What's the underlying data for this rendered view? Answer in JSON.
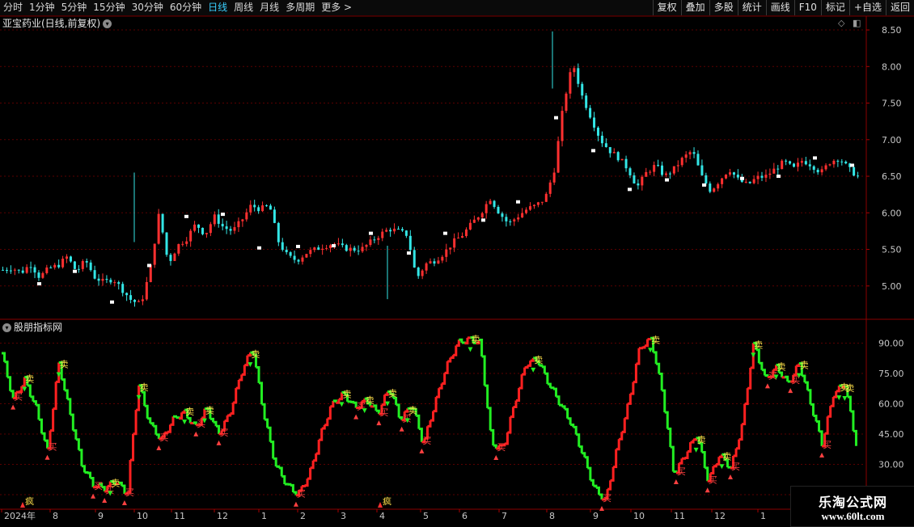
{
  "toolbar": {
    "periods": [
      {
        "label": "分时",
        "active": false
      },
      {
        "label": "1分钟",
        "active": false
      },
      {
        "label": "5分钟",
        "active": false
      },
      {
        "label": "15分钟",
        "active": false
      },
      {
        "label": "30分钟",
        "active": false
      },
      {
        "label": "60分钟",
        "active": false
      },
      {
        "label": "日线",
        "active": true
      },
      {
        "label": "周线",
        "active": false
      },
      {
        "label": "月线",
        "active": false
      },
      {
        "label": "多周期",
        "active": false
      },
      {
        "label": "更多 >",
        "active": false
      }
    ],
    "actions": [
      "复权",
      "叠加",
      "多股",
      "统计",
      "画线",
      "F10",
      "标记",
      "+自选",
      "返回"
    ]
  },
  "main_panel": {
    "title": "亚宝药业(日线,前复权)"
  },
  "indicator_panel": {
    "title": "股朋指标网"
  },
  "watermark": {
    "name": "乐淘公式网",
    "url": "www.60lt.com"
  },
  "colors": {
    "up": "#ff3030",
    "down": "#33e6e6",
    "ind_up": "#ff2020",
    "ind_down": "#22ee22",
    "grid": "#5a0000",
    "axis": "#c8c8c8"
  },
  "signal_labels": {
    "buy": "买",
    "sell": "卖",
    "crazy": "疯"
  },
  "chart_data": [
    {
      "type": "candlestick",
      "title": "亚宝药业(日线,前复权)",
      "y_ticks": [
        5.0,
        5.5,
        6.0,
        6.5,
        7.0,
        7.5,
        8.0,
        8.5
      ],
      "ylim": [
        4.6,
        8.6
      ],
      "close_path": [
        5.22,
        5.25,
        5.18,
        5.3,
        5.12,
        5.24,
        5.28,
        5.4,
        5.2,
        5.35,
        5.12,
        5.05,
        5.1,
        4.95,
        4.8,
        4.75,
        5.2,
        6.0,
        5.3,
        5.55,
        5.65,
        5.85,
        5.7,
        5.95,
        5.8,
        5.75,
        5.9,
        6.1,
        6.05,
        6.1,
        5.6,
        5.4,
        5.35,
        5.45,
        5.5,
        5.55,
        5.58,
        5.52,
        5.5,
        5.5,
        5.6,
        5.7,
        5.78,
        5.75,
        5.7,
        5.1,
        5.3,
        5.35,
        5.45,
        5.6,
        5.7,
        5.85,
        6.0,
        6.2,
        6.0,
        5.85,
        5.95,
        6.05,
        6.1,
        6.2,
        6.6,
        7.5,
        8.05,
        7.6,
        7.3,
        7.0,
        6.85,
        6.75,
        6.6,
        6.35,
        6.55,
        6.65,
        6.5,
        6.6,
        6.75,
        6.85,
        6.5,
        6.3,
        6.45,
        6.6,
        6.45,
        6.38,
        6.48,
        6.5,
        6.6,
        6.7,
        6.6,
        6.72,
        6.65,
        6.55,
        6.7,
        6.75,
        6.6,
        6.5
      ],
      "markers": [
        {
          "kind": "crazy",
          "month": "8"
        },
        {
          "kind": "crazy",
          "month": "4"
        }
      ]
    },
    {
      "type": "line",
      "title": "股朋指标网",
      "y_ticks": [
        15.0,
        30.0,
        45.0,
        60.0,
        75.0,
        90.0
      ],
      "ylim": [
        15,
        95
      ],
      "series_path": [
        85,
        62,
        72,
        58,
        36,
        80,
        55,
        30,
        20,
        18,
        22,
        15,
        70,
        50,
        42,
        52,
        56,
        48,
        58,
        45,
        55,
        75,
        88,
        55,
        30,
        20,
        15,
        25,
        45,
        60,
        65,
        58,
        62,
        55,
        68,
        52,
        60,
        40,
        60,
        78,
        90,
        92,
        90,
        40,
        38,
        60,
        80,
        82,
        70,
        60,
        50,
        35,
        18,
        12,
        38,
        60,
        88,
        92,
        65,
        25,
        35,
        45,
        22,
        35,
        28,
        50,
        90,
        72,
        78,
        70,
        80,
        60,
        40,
        65,
        70,
        40
      ],
      "x_labels": [
        "2024年",
        "8",
        "9",
        "10",
        "11",
        "12",
        "1",
        "2",
        "3",
        "4",
        "5",
        "6",
        "7",
        "8",
        "9",
        "10",
        "11",
        "12",
        "1"
      ]
    }
  ]
}
